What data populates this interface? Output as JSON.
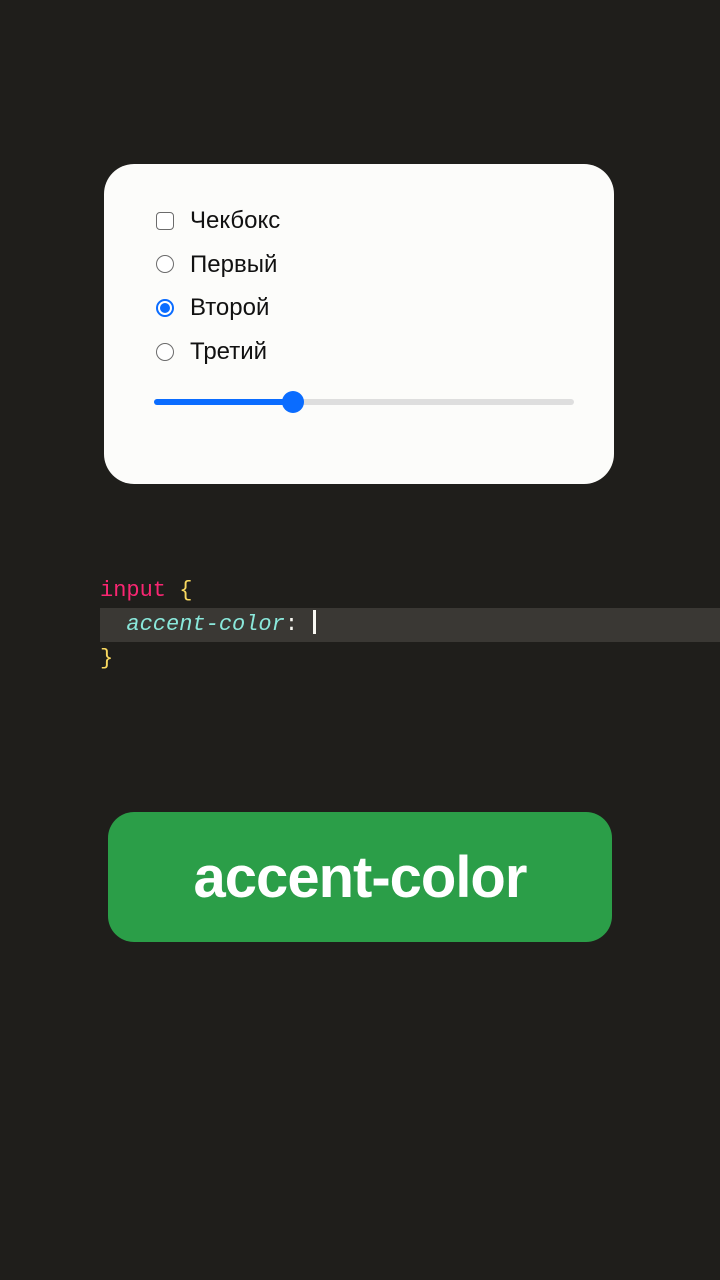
{
  "card": {
    "checkbox": {
      "label": "Чекбокс",
      "checked": false
    },
    "radios": [
      {
        "label": "Первый",
        "checked": false
      },
      {
        "label": "Второй",
        "checked": true
      },
      {
        "label": "Третий",
        "checked": false
      }
    ],
    "slider": {
      "value": 33,
      "min": 0,
      "max": 100
    },
    "accent_color": "#0a6cff"
  },
  "code": {
    "selector": "input",
    "brace_open": "{",
    "property": "accent-color",
    "colon": ":",
    "value": "",
    "brace_close": "}"
  },
  "pill": {
    "label": "accent-color"
  },
  "colors": {
    "background": "#1f1e1b",
    "pill_bg": "#2b9e48",
    "accent": "#0a6cff"
  }
}
